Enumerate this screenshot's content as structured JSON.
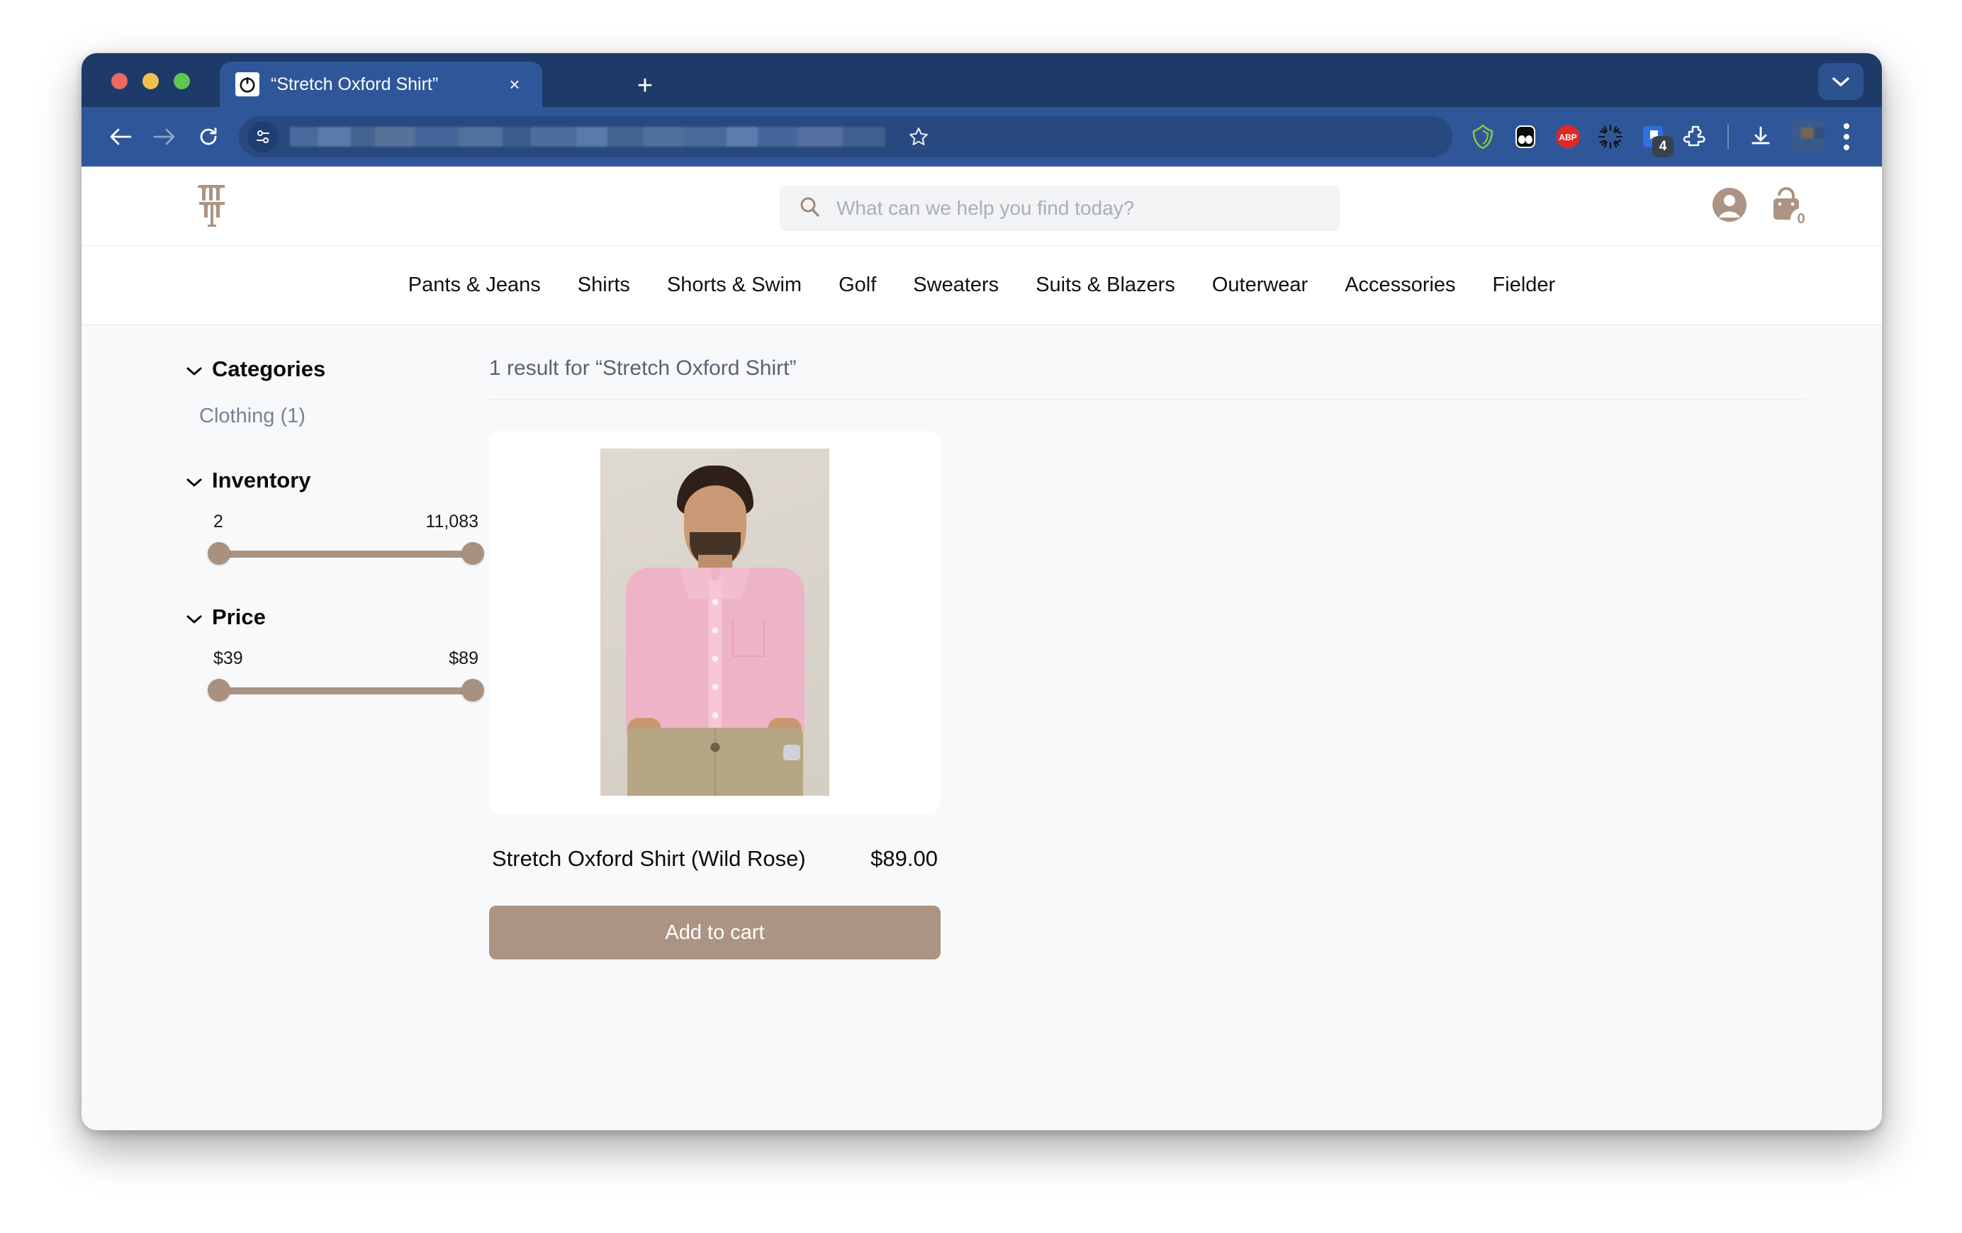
{
  "browser": {
    "tab": {
      "title": "“Stretch Oxford Shirt”",
      "favicon_name": "power-button-favicon",
      "close_label": "×"
    },
    "new_tab_label": "+",
    "tablist_icon": "chevron-down-icon",
    "nav": {
      "back_icon": "back-arrow-icon",
      "forward_icon": "forward-arrow-icon",
      "reload_icon": "reload-icon"
    },
    "omnibox": {
      "site_settings_icon": "tune-sliders-icon",
      "url_value": "",
      "bookmark_icon": "star-outline-icon"
    },
    "extensions": [
      {
        "name": "shield-extension-icon",
        "badge": ""
      },
      {
        "name": "goggles-extension-icon",
        "badge": ""
      },
      {
        "name": "adblock-plus-icon",
        "label": "ABP",
        "badge": ""
      },
      {
        "name": "starburst-extension-icon",
        "badge": ""
      },
      {
        "name": "notes-extension-icon",
        "badge": "4"
      },
      {
        "name": "puzzle-extensions-icon",
        "badge": ""
      }
    ],
    "download_icon": "download-icon",
    "profile_icon": "profile-avatar",
    "menu_icon": "three-dot-menu-icon"
  },
  "site": {
    "logo_name": "stacked-t-monogram-logo",
    "search": {
      "icon": "search-icon",
      "placeholder": "What can we help you find today?",
      "value": ""
    },
    "account_icon": "account-circle-icon",
    "cart": {
      "icon": "shopping-bag-icon",
      "count": "0"
    },
    "nav_items": [
      {
        "label": "Pants & Jeans"
      },
      {
        "label": "Shirts"
      },
      {
        "label": "Shorts & Swim"
      },
      {
        "label": "Golf"
      },
      {
        "label": "Sweaters"
      },
      {
        "label": "Suits & Blazers"
      },
      {
        "label": "Outerwear"
      },
      {
        "label": "Accessories"
      },
      {
        "label": "Fielder"
      }
    ]
  },
  "sidebar": {
    "categories": {
      "title": "Categories",
      "chevron": "chevron-down-icon",
      "items": [
        {
          "label": "Clothing (1)"
        }
      ]
    },
    "inventory": {
      "title": "Inventory",
      "chevron": "chevron-down-icon",
      "min_label": "2",
      "max_label": "11,083"
    },
    "price": {
      "title": "Price",
      "chevron": "chevron-down-icon",
      "min_label": "$39",
      "max_label": "$89"
    }
  },
  "results": {
    "count_text": "1 result for “Stretch Oxford Shirt”",
    "products": [
      {
        "title": "Stretch Oxford Shirt (Wild Rose)",
        "price": "$89.00",
        "image_alt": "man wearing pink oxford shirt and khaki pants",
        "add_to_cart_label": "Add to cart"
      }
    ]
  },
  "colors": {
    "brand_tan": "#ab9483",
    "browser_chrome": "#2f5699",
    "tabstrip": "#1e3a68",
    "page_bg": "#f8f9fb",
    "shirt_pink": "#efb3c8"
  }
}
